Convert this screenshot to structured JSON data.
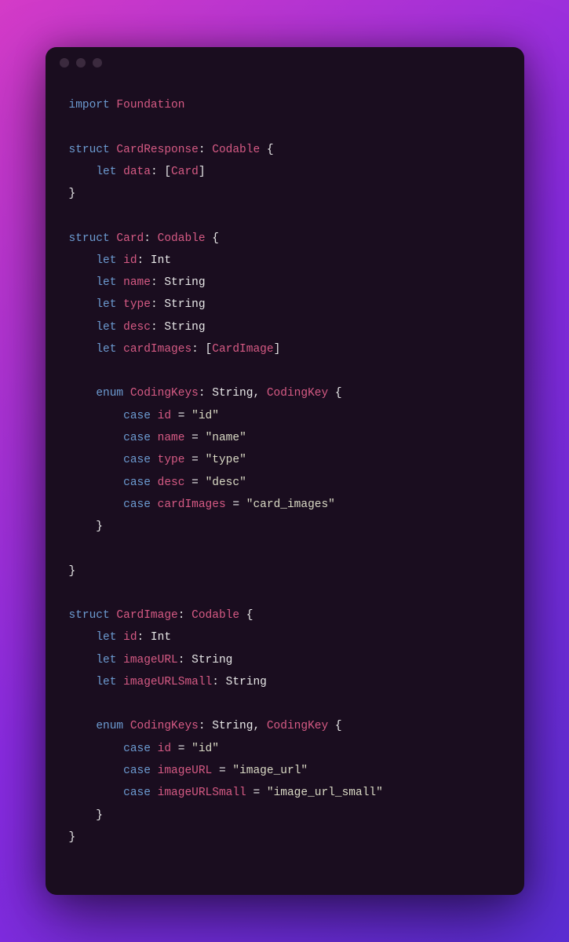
{
  "code": {
    "tokens": [
      [
        [
          "kw",
          "import"
        ],
        [
          "pl",
          " "
        ],
        [
          "type",
          "Foundation"
        ]
      ],
      [],
      [
        [
          "kw",
          "struct"
        ],
        [
          "pl",
          " "
        ],
        [
          "type",
          "CardResponse"
        ],
        [
          "pl",
          ": "
        ],
        [
          "type",
          "Codable"
        ],
        [
          "pl",
          " {"
        ]
      ],
      [
        [
          "pl",
          "    "
        ],
        [
          "kw",
          "let"
        ],
        [
          "pl",
          " "
        ],
        [
          "id",
          "data"
        ],
        [
          "pl",
          ": ["
        ],
        [
          "type",
          "Card"
        ],
        [
          "pl",
          "]"
        ]
      ],
      [
        [
          "pl",
          "}"
        ]
      ],
      [],
      [
        [
          "kw",
          "struct"
        ],
        [
          "pl",
          " "
        ],
        [
          "type",
          "Card"
        ],
        [
          "pl",
          ": "
        ],
        [
          "type",
          "Codable"
        ],
        [
          "pl",
          " {"
        ]
      ],
      [
        [
          "pl",
          "    "
        ],
        [
          "kw",
          "let"
        ],
        [
          "pl",
          " "
        ],
        [
          "id",
          "id"
        ],
        [
          "pl",
          ": Int"
        ]
      ],
      [
        [
          "pl",
          "    "
        ],
        [
          "kw",
          "let"
        ],
        [
          "pl",
          " "
        ],
        [
          "id",
          "name"
        ],
        [
          "pl",
          ": String"
        ]
      ],
      [
        [
          "pl",
          "    "
        ],
        [
          "kw",
          "let"
        ],
        [
          "pl",
          " "
        ],
        [
          "id",
          "type"
        ],
        [
          "pl",
          ": String"
        ]
      ],
      [
        [
          "pl",
          "    "
        ],
        [
          "kw",
          "let"
        ],
        [
          "pl",
          " "
        ],
        [
          "id",
          "desc"
        ],
        [
          "pl",
          ": String"
        ]
      ],
      [
        [
          "pl",
          "    "
        ],
        [
          "kw",
          "let"
        ],
        [
          "pl",
          " "
        ],
        [
          "id",
          "cardImages"
        ],
        [
          "pl",
          ": ["
        ],
        [
          "type",
          "CardImage"
        ],
        [
          "pl",
          "]"
        ]
      ],
      [],
      [
        [
          "pl",
          "    "
        ],
        [
          "kw",
          "enum"
        ],
        [
          "pl",
          " "
        ],
        [
          "type",
          "CodingKeys"
        ],
        [
          "pl",
          ": String, "
        ],
        [
          "type",
          "CodingKey"
        ],
        [
          "pl",
          " {"
        ]
      ],
      [
        [
          "pl",
          "        "
        ],
        [
          "kw",
          "case"
        ],
        [
          "pl",
          " "
        ],
        [
          "id",
          "id"
        ],
        [
          "pl",
          " = "
        ],
        [
          "str",
          "\"id\""
        ]
      ],
      [
        [
          "pl",
          "        "
        ],
        [
          "kw",
          "case"
        ],
        [
          "pl",
          " "
        ],
        [
          "id",
          "name"
        ],
        [
          "pl",
          " = "
        ],
        [
          "str",
          "\"name\""
        ]
      ],
      [
        [
          "pl",
          "        "
        ],
        [
          "kw",
          "case"
        ],
        [
          "pl",
          " "
        ],
        [
          "id",
          "type"
        ],
        [
          "pl",
          " = "
        ],
        [
          "str",
          "\"type\""
        ]
      ],
      [
        [
          "pl",
          "        "
        ],
        [
          "kw",
          "case"
        ],
        [
          "pl",
          " "
        ],
        [
          "id",
          "desc"
        ],
        [
          "pl",
          " = "
        ],
        [
          "str",
          "\"desc\""
        ]
      ],
      [
        [
          "pl",
          "        "
        ],
        [
          "kw",
          "case"
        ],
        [
          "pl",
          " "
        ],
        [
          "id",
          "cardImages"
        ],
        [
          "pl",
          " = "
        ],
        [
          "str",
          "\"card_images\""
        ]
      ],
      [
        [
          "pl",
          "    }"
        ]
      ],
      [],
      [
        [
          "pl",
          "}"
        ]
      ],
      [],
      [
        [
          "kw",
          "struct"
        ],
        [
          "pl",
          " "
        ],
        [
          "type",
          "CardImage"
        ],
        [
          "pl",
          ": "
        ],
        [
          "type",
          "Codable"
        ],
        [
          "pl",
          " {"
        ]
      ],
      [
        [
          "pl",
          "    "
        ],
        [
          "kw",
          "let"
        ],
        [
          "pl",
          " "
        ],
        [
          "id",
          "id"
        ],
        [
          "pl",
          ": Int"
        ]
      ],
      [
        [
          "pl",
          "    "
        ],
        [
          "kw",
          "let"
        ],
        [
          "pl",
          " "
        ],
        [
          "id",
          "imageURL"
        ],
        [
          "pl",
          ": String"
        ]
      ],
      [
        [
          "pl",
          "    "
        ],
        [
          "kw",
          "let"
        ],
        [
          "pl",
          " "
        ],
        [
          "id",
          "imageURLSmall"
        ],
        [
          "pl",
          ": String"
        ]
      ],
      [],
      [
        [
          "pl",
          "    "
        ],
        [
          "kw",
          "enum"
        ],
        [
          "pl",
          " "
        ],
        [
          "type",
          "CodingKeys"
        ],
        [
          "pl",
          ": String, "
        ],
        [
          "type",
          "CodingKey"
        ],
        [
          "pl",
          " {"
        ]
      ],
      [
        [
          "pl",
          "        "
        ],
        [
          "kw",
          "case"
        ],
        [
          "pl",
          " "
        ],
        [
          "id",
          "id"
        ],
        [
          "pl",
          " = "
        ],
        [
          "str",
          "\"id\""
        ]
      ],
      [
        [
          "pl",
          "        "
        ],
        [
          "kw",
          "case"
        ],
        [
          "pl",
          " "
        ],
        [
          "id",
          "imageURL"
        ],
        [
          "pl",
          " = "
        ],
        [
          "str",
          "\"image_url\""
        ]
      ],
      [
        [
          "pl",
          "        "
        ],
        [
          "kw",
          "case"
        ],
        [
          "pl",
          " "
        ],
        [
          "id",
          "imageURLSmall"
        ],
        [
          "pl",
          " = "
        ],
        [
          "str",
          "\"image_url_small\""
        ]
      ],
      [
        [
          "pl",
          "    }"
        ]
      ],
      [
        [
          "pl",
          "}"
        ]
      ]
    ]
  }
}
